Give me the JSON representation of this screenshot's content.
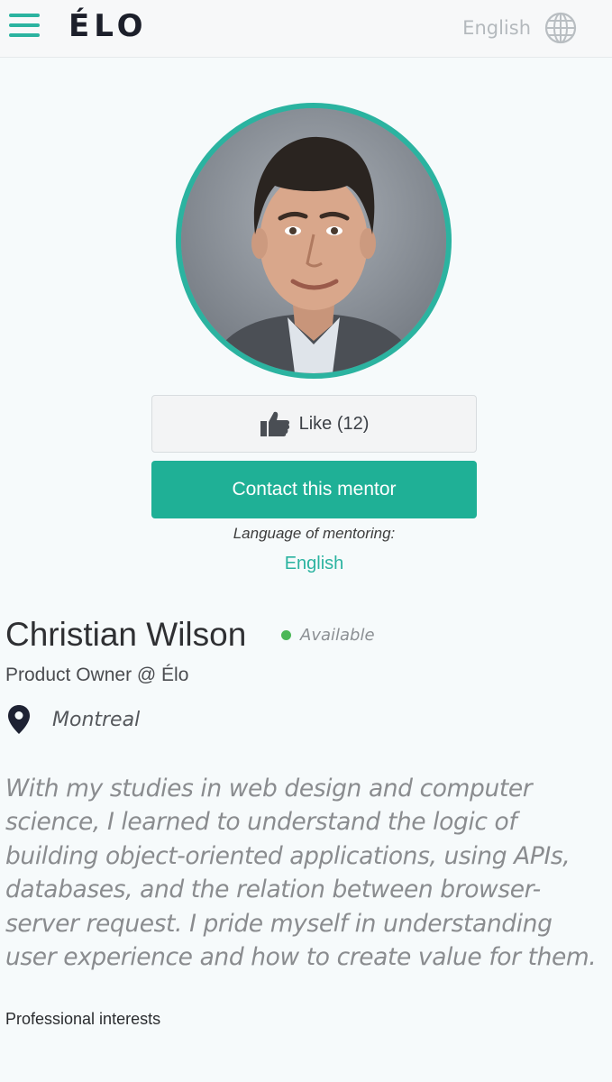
{
  "header": {
    "logo": "ÉLO",
    "language": "English",
    "menu_icon": "hamburger-menu-icon",
    "language_icon": "globe-icon",
    "accent_color": "#2bb3a0"
  },
  "profile": {
    "like_label": "Like (12)",
    "like_icon": "thumbs-up-icon",
    "contact_label": "Contact this mentor",
    "mentoring_language_label": "Language of mentoring:",
    "mentoring_language": "English",
    "name": "Christian Wilson",
    "status": "Available",
    "status_color": "#4cb757",
    "role": "Product Owner @ Élo",
    "location_icon": "map-pin-icon",
    "location": "Montreal",
    "bio_lines": [
      "With my studies in web design and computer",
      "science, I learned to understand the logic of",
      "building object-oriented applications, using APIs,",
      "databases, and the relation between browser-",
      "server request. I pride myself in understanding",
      "user experience and how to create value for them."
    ],
    "interests_heading": "Professional interests"
  }
}
